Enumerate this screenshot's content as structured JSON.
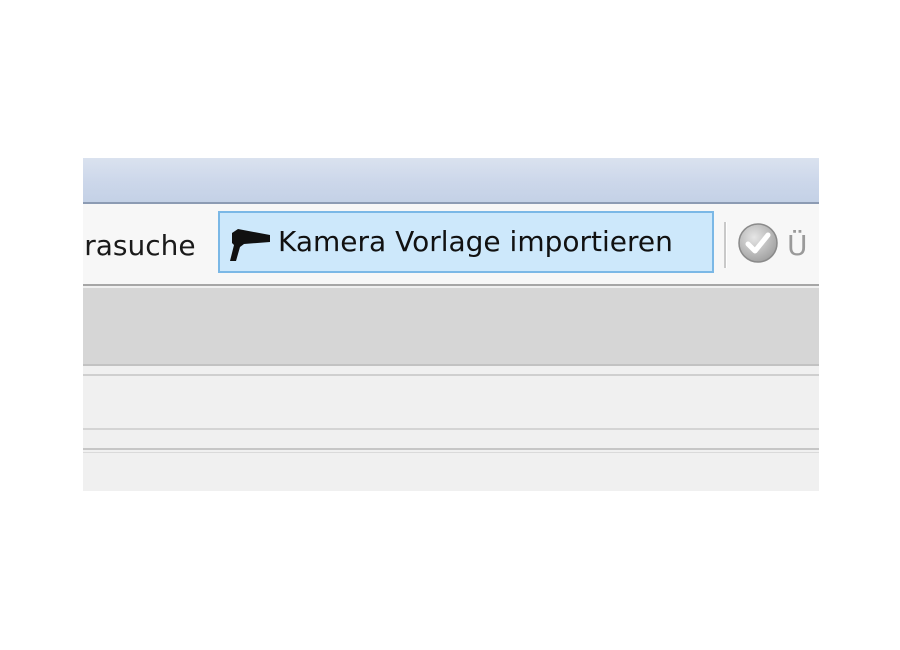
{
  "toolbar": {
    "left_partial_label": "erasuche",
    "import_button": {
      "label": "Kamera Vorlage importieren",
      "icon": "camera-icon"
    },
    "right_partial_label": "Ü",
    "right_icon": "check-icon"
  },
  "colors": {
    "title_band": "#ccd7ea",
    "button_highlight": "#cde8fb",
    "button_border": "#7bb8e6",
    "panel_grey": "#d6d6d6",
    "row_bg": "#f0f0f0"
  }
}
